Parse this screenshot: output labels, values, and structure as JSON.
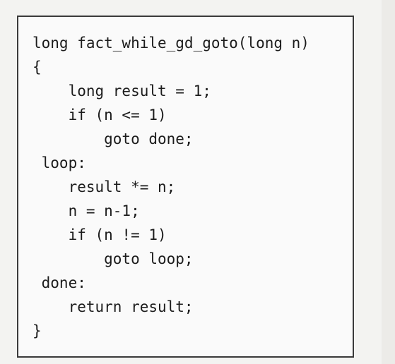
{
  "code": {
    "lines": [
      "long fact_while_gd_goto(long n)",
      "{",
      "    long result = 1;",
      "    if (n <= 1)",
      "        goto done;",
      " loop:",
      "    result *= n;",
      "    n = n-1;",
      "    if (n != 1)",
      "        goto loop;",
      " done:",
      "    return result;",
      "}"
    ]
  }
}
